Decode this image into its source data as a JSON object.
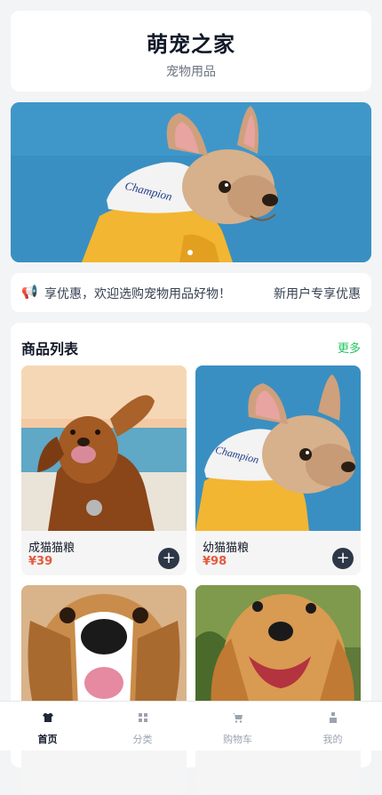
{
  "header": {
    "title": "萌宠之家",
    "subtitle": "宠物用品"
  },
  "banner": {
    "image_alt": "french-bulldog-in-yellow-hoodie",
    "hoodie_text": "Champion"
  },
  "notice": {
    "icon": "megaphone-icon",
    "scrolling_text": "享优惠，欢迎选购宠物用品好物！",
    "right_text": "新用户专享优惠"
  },
  "products": {
    "title": "商品列表",
    "more_label": "更多",
    "items": [
      {
        "name": "成猫猫粮",
        "price": "¥39",
        "image": "golden-retriever-beach"
      },
      {
        "name": "幼猫猫粮",
        "price": "¥98",
        "image": "french-bulldog-hoodie"
      },
      {
        "name": "",
        "price": "",
        "image": "beagle-closeup"
      },
      {
        "name": "",
        "price": "",
        "image": "cocker-spaniel-grass"
      }
    ],
    "add_label": "+"
  },
  "tabbar": {
    "items": [
      {
        "label": "首页",
        "icon": "shirt-icon",
        "active": true
      },
      {
        "label": "分类",
        "icon": "grid-icon",
        "active": false
      },
      {
        "label": "购物车",
        "icon": "cart-icon",
        "active": false
      },
      {
        "label": "我的",
        "icon": "user-icon",
        "active": false
      }
    ]
  },
  "colors": {
    "accent_green": "#22c55e",
    "price_red": "#e25a3f",
    "button_dark": "#2d3748"
  }
}
